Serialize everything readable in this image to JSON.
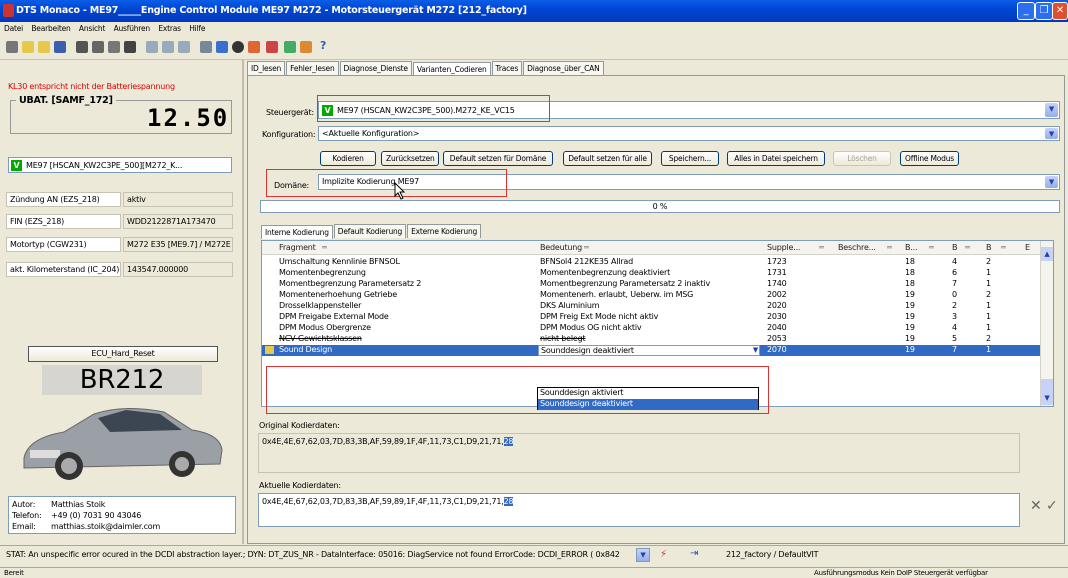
{
  "window": {
    "title": "DTS Monaco  - ME97_____Engine Control Module ME97 M272 - Motorsteuergerät M272 [212_factory]"
  },
  "menu": [
    "Datei",
    "Bearbeiten",
    "Ansicht",
    "Ausführen",
    "Extras",
    "Hilfe"
  ],
  "left": {
    "battery_warning": "KL30 entspricht nicht der Batteriespannung",
    "voltage_label": "UBAT. [SAMF_172]",
    "voltage_value": "12.50",
    "ecu_variant": "ME97 [HSCAN_KW2C3PE_500][M272_K...",
    "info_rows": [
      {
        "label": "Zündung AN (EZS_218)",
        "value": "aktiv"
      },
      {
        "label": "FIN  (EZS_218)",
        "value": "WDD2122871A173470"
      },
      {
        "label": "Motortyp (CGW231)",
        "value": "M272 E35 [ME9.7] / M272E"
      },
      {
        "label": "akt. Kilometerstand (IC_204)",
        "value": "143547.000000"
      }
    ],
    "reset_button": "ECU_Hard_Reset",
    "model": "BR212",
    "author_label": "Autor:",
    "author": "Matthias Stoik",
    "phone_label": "Telefon:",
    "phone": "+49 (0) 7031 90 43046",
    "email_label": "Email:",
    "email": "matthias.stoik@daimler.com"
  },
  "tabs": [
    "ID_lesen",
    "Fehler_lesen",
    "Diagnose_Dienste",
    "Varianten_Codieren",
    "Traces",
    "Diagnose_über_CAN"
  ],
  "active_tab": "Varianten_Codieren",
  "coding": {
    "ecu_label": "Steuergerät:",
    "ecu_value": "ME97 (HSCAN_KW2C3PE_500).M272_KE_VC15",
    "config_label": "Konfiguration:",
    "config_value": "<Aktuelle Konfiguration>",
    "buttons": [
      "Kodieren",
      "Zurücksetzen",
      "Default setzen für Domäne",
      "Default setzen für alle",
      "Speichern...",
      "Alles in Datei speichern",
      "Löschen",
      "Offline Modus"
    ],
    "domain_label": "Domäne:",
    "domain_value": "Implizite Kodierung ME97",
    "progress_text": "0 %",
    "progress": 0,
    "sub_tabs": [
      "Interne Kodierung",
      "Default Kodierung",
      "Externe Kodierung"
    ],
    "grid_headers": [
      "Fragment",
      "Bedeutung",
      "Supple...",
      "Beschre...",
      "B...",
      "B",
      "B",
      "E"
    ],
    "rows": [
      [
        "Umschaltung Kennlinie BFNSOL",
        "BFNSol4 212KE35 Allrad",
        "1723",
        "18",
        "4",
        "2"
      ],
      [
        "Momentenbegrenzung",
        "Momentenbegrenzung deaktiviert",
        "1731",
        "18",
        "6",
        "1"
      ],
      [
        "Momentbegrenzung Parametersatz 2",
        "Momentbegrenzung Parametersatz 2 inaktiv",
        "1740",
        "18",
        "7",
        "1"
      ],
      [
        "Momentenerhoehung Getriebe",
        "Momentenerh. erlaubt, Ueberw. im MSG",
        "2002",
        "19",
        "0",
        "2"
      ],
      [
        "Drosselklappensteller",
        "DKS Aluminium",
        "2020",
        "19",
        "2",
        "1"
      ],
      [
        "DPM Freigabe External Mode",
        "DPM Freig Ext Mode nicht aktiv",
        "2030",
        "19",
        "3",
        "1"
      ],
      [
        "DPM Modus Obergrenze",
        "DPM Modus OG nicht aktiv",
        "2040",
        "19",
        "4",
        "1"
      ],
      [
        "NCV-Gewichtsklassen",
        "nicht belegt",
        "2053",
        "19",
        "5",
        "2"
      ],
      [
        "Sound Design",
        "Sounddesign deaktiviert",
        "2070",
        "19",
        "7",
        "1"
      ]
    ],
    "dropdown_options": [
      "Sounddesign aktiviert",
      "Sounddesign deaktiviert"
    ],
    "orig_label": "Original Kodierdaten:",
    "orig_data": "0x4E,4E,67,62,03,7D,83,3B,AF,59,89,1F,4F,11,73,C1,D9,21,71,",
    "orig_highlight": "28",
    "curr_label": "Aktuelle Kodierdaten:",
    "curr_data": "0x4E,4E,67,62,03,7D,83,3B,AF,59,89,1F,4F,11,73,C1,D9,21,71,",
    "curr_highlight": "28"
  },
  "status": {
    "message": "STAT: An unspecific error ocured in the DCDI abstraction layer.; DYN: DT_ZUS_NR - DataInterface: 05016: DiagService not found ErrorCode: DCDI_ERROR  ( 0x842",
    "workspace": "212_factory / DefaultVIT",
    "ready": "Bereit",
    "mode": "Ausführungsmodus  Kein DoIP Steuergerät verfügbar"
  }
}
